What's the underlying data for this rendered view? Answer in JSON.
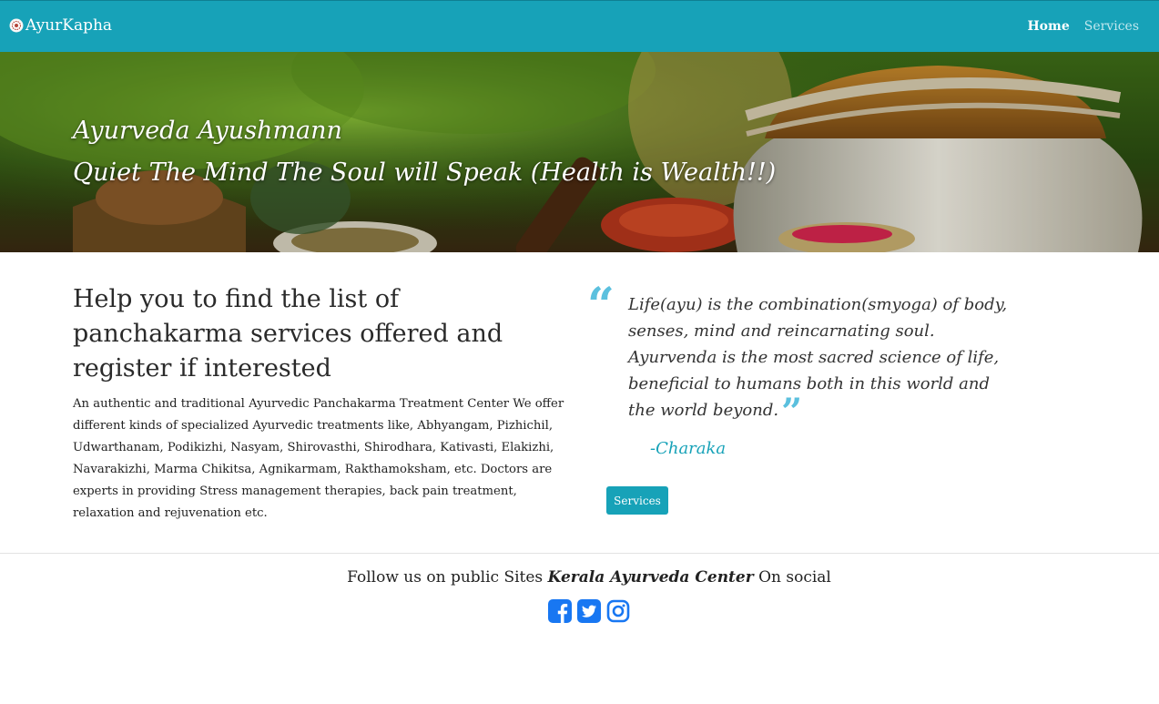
{
  "nav": {
    "brand": "AyurKapha",
    "links": [
      {
        "label": "Home"
      },
      {
        "label": "Services"
      }
    ]
  },
  "hero": {
    "title": "Ayurveda Ayushmann",
    "subtitle": "Quiet The Mind The Soul will Speak (Health is Wealth!!)"
  },
  "intro": {
    "heading": "Help you to find the list of panchakarma services offered and register if interested",
    "body": "An authentic and traditional Ayurvedic Panchakarma Treatment Center We offer different kinds of specialized Ayurvedic treatments like, Abhyangam, Pizhichil, Udwarthanam, Podikizhi, Nasyam, Shirovasthi, Shirodhara, Kativasti, Elakizhi, Navarakizhi, Marma Chikitsa, Agnikarmam, Rakthamoksham, etc. Doctors are experts in providing Stress management therapies, back pain treatment, relaxation and rejuvenation etc."
  },
  "quote": {
    "open_mark": "“",
    "text": "Life(ayu) is the combination(smyoga) of body, senses, mind and reincarnating soul. Ayurvenda is the most sacred science of life, beneficial to humans both in this world and the world beyond.",
    "close_mark": "”",
    "author": "-Charaka"
  },
  "cta": {
    "label": "Services"
  },
  "footer": {
    "follow_prefix": "Follow us on public Sites ",
    "center_name": "Kerala Ayurveda Center",
    "follow_suffix": " On social",
    "social_icons": [
      "facebook-icon",
      "twitter-icon",
      "instagram-icon"
    ]
  },
  "colors": {
    "primary": "#17a2b8",
    "quote_mark": "#5bc0de",
    "social": "#1877f2"
  }
}
